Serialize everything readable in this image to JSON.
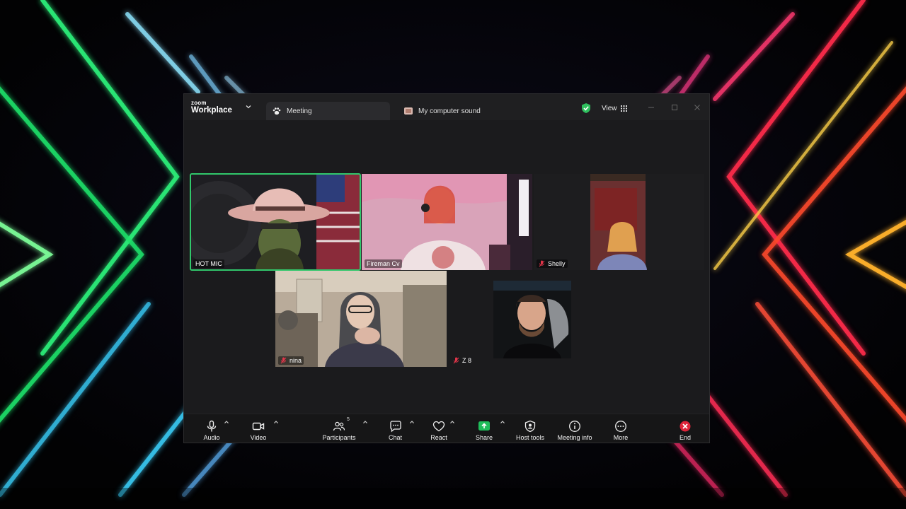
{
  "window": {
    "brand_top": "zoom",
    "brand_bottom": "Workplace",
    "tabs": [
      {
        "label": "Meeting",
        "icon": "paw-icon"
      },
      {
        "label": "My computer sound",
        "icon": "sound-share-icon"
      }
    ],
    "view_label": "View",
    "accent_green": "#31c76b"
  },
  "participants": [
    {
      "name": "HOT MIC",
      "muted": false,
      "active_speaker": true
    },
    {
      "name": "Fireman Cv",
      "muted": false,
      "active_speaker": false
    },
    {
      "name": "Shelly",
      "muted": true,
      "active_speaker": false
    },
    {
      "name": "nina",
      "muted": true,
      "active_speaker": false
    },
    {
      "name": "Z 8",
      "muted": true,
      "active_speaker": false
    },
    {
      "name": "",
      "muted": false,
      "active_speaker": false
    }
  ],
  "toolbar": {
    "audio": "Audio",
    "video": "Video",
    "participants": "Participants",
    "participants_count": "5",
    "chat": "Chat",
    "react": "React",
    "share": "Share",
    "host_tools": "Host tools",
    "meeting_info": "Meeting info",
    "more": "More",
    "end": "End",
    "share_color": "#1fbd5a",
    "end_color": "#e0243a"
  }
}
